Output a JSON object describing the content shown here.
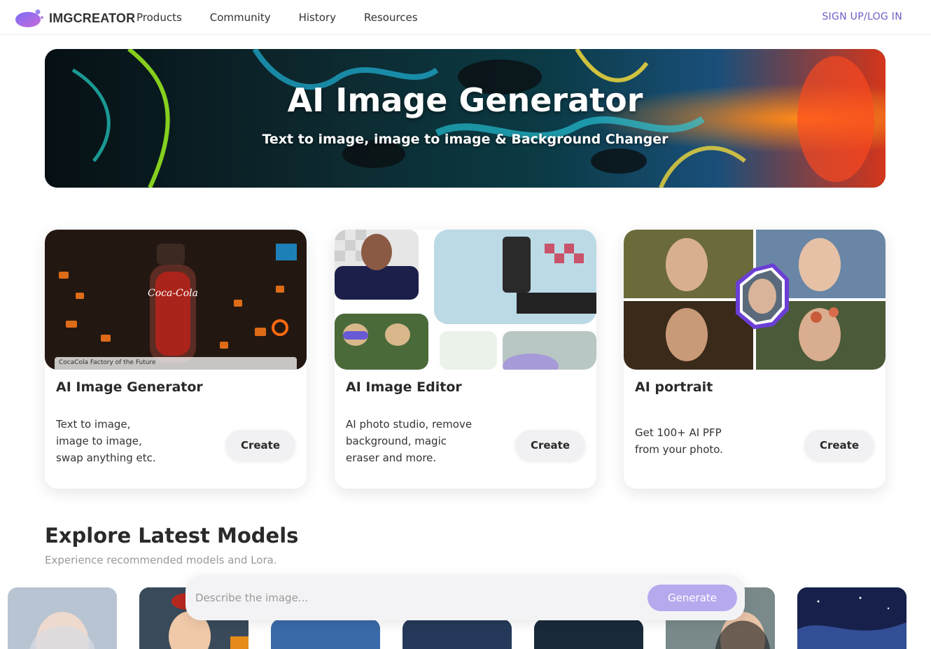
{
  "header": {
    "logo_text": "IMGCREATOR",
    "nav": [
      "Products",
      "Community",
      "History",
      "Resources"
    ],
    "signup_label": "SIGN UP/LOG IN"
  },
  "hero": {
    "title": "AI Image Generator",
    "subtitle": "Text to image, image to image & Background Changer"
  },
  "cards": [
    {
      "title": "AI Image Generator",
      "desc_lines": [
        "Text to image,",
        "image to image,",
        "swap anything etc."
      ],
      "button": "Create",
      "caption": "CocaCola Factory of the Future"
    },
    {
      "title": "AI Image Editor",
      "desc_lines": [
        "AI photo studio, remove",
        "background, magic",
        "eraser and more."
      ],
      "button": "Create"
    },
    {
      "title": "AI portrait",
      "desc_lines": [
        "Get 100+ AI PFP",
        "from your photo."
      ],
      "button": "Create"
    }
  ],
  "explore": {
    "title": "Explore Latest Models",
    "subtitle": "Experience recommended models and Lora."
  },
  "prompt": {
    "placeholder": "Describe the image...",
    "button": "Generate"
  },
  "colors": {
    "accent": "#6a5fc6",
    "generate_button": "#b7a9ee"
  }
}
